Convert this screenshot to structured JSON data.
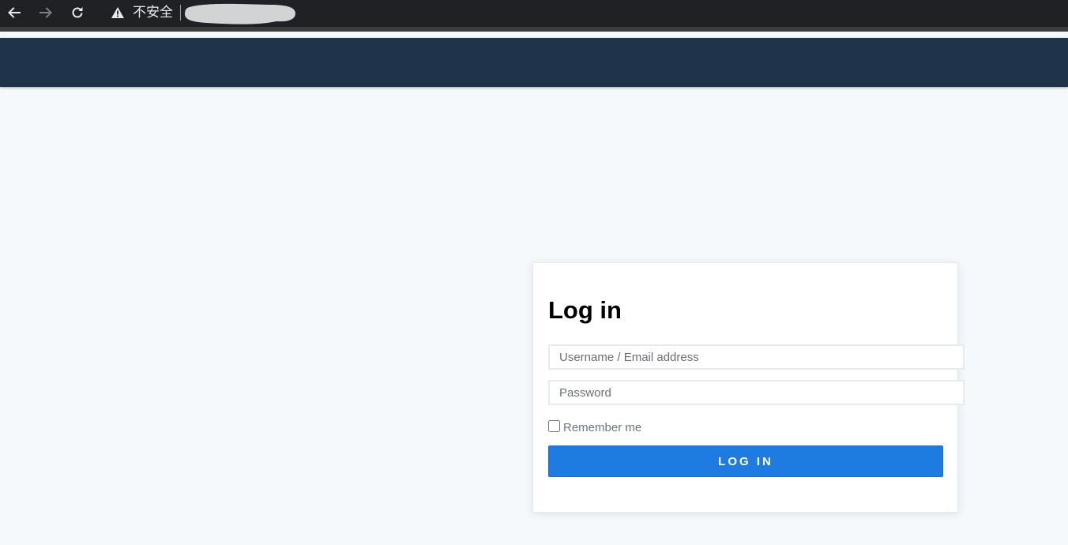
{
  "browser": {
    "security_label": "不安全",
    "icons": {
      "back": "arrow-left-icon",
      "forward": "arrow-right-icon",
      "reload": "reload-icon",
      "warning": "warning-triangle-icon"
    }
  },
  "login": {
    "title": "Log in",
    "username_placeholder": "Username / Email address",
    "password_placeholder": "Password",
    "remember_label": "Remember me",
    "remember_checked": false,
    "submit_label": "LOG IN"
  },
  "colors": {
    "header": "#1f3349",
    "page_background": "#f5f9fc",
    "button": "#1e7be2"
  }
}
